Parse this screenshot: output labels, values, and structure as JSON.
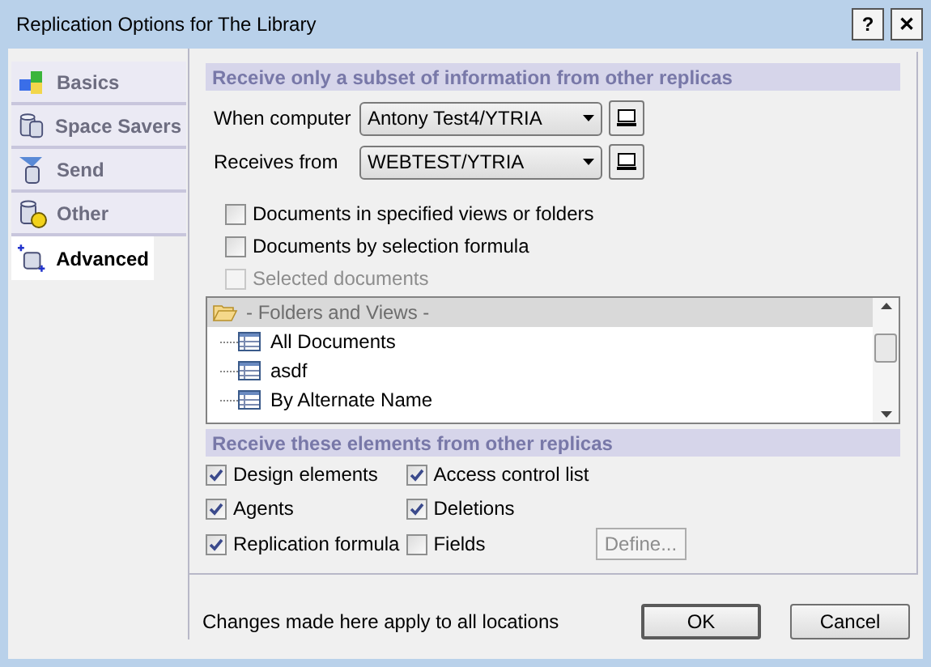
{
  "window": {
    "title": "Replication Options for The Library",
    "buttons": [
      "?",
      "✕"
    ]
  },
  "tabs": [
    {
      "label": "Basics",
      "selected": false,
      "kind": "basics"
    },
    {
      "label": "Space Savers",
      "selected": false,
      "kind": "space"
    },
    {
      "label": "Send",
      "selected": false,
      "kind": "send"
    },
    {
      "label": "Other",
      "selected": false,
      "kind": "other"
    },
    {
      "label": "Advanced",
      "selected": true,
      "kind": "advanced"
    }
  ],
  "subset": {
    "heading": "Receive only a subset of information from other replicas",
    "when_computer": {
      "label": "When computer",
      "value": "Antony Test4/YTRIA"
    },
    "receives_from": {
      "label": "Receives from",
      "value": "WEBTEST/YTRIA"
    },
    "options": [
      {
        "label": "Documents in specified views or folders",
        "checked": false,
        "disabled": false
      },
      {
        "label": "Documents by selection formula",
        "checked": false,
        "disabled": false
      },
      {
        "label": "Selected documents",
        "checked": false,
        "disabled": true
      }
    ],
    "tree": {
      "header": "- Folders and Views -",
      "items": [
        "All Documents",
        "asdf",
        "By Alternate Name"
      ]
    }
  },
  "elements": {
    "heading": "Receive these elements from other replicas",
    "items": [
      {
        "label": "Design elements",
        "checked": true
      },
      {
        "label": "Access control list",
        "checked": true
      },
      {
        "label": "Agents",
        "checked": true
      },
      {
        "label": "Deletions",
        "checked": true
      },
      {
        "label": "Replication formula",
        "checked": true
      },
      {
        "label": "Fields",
        "checked": false
      }
    ],
    "define_button": "Define..."
  },
  "footer": {
    "note": "Changes made here apply to all locations",
    "buttons": [
      "OK",
      "Cancel"
    ]
  }
}
